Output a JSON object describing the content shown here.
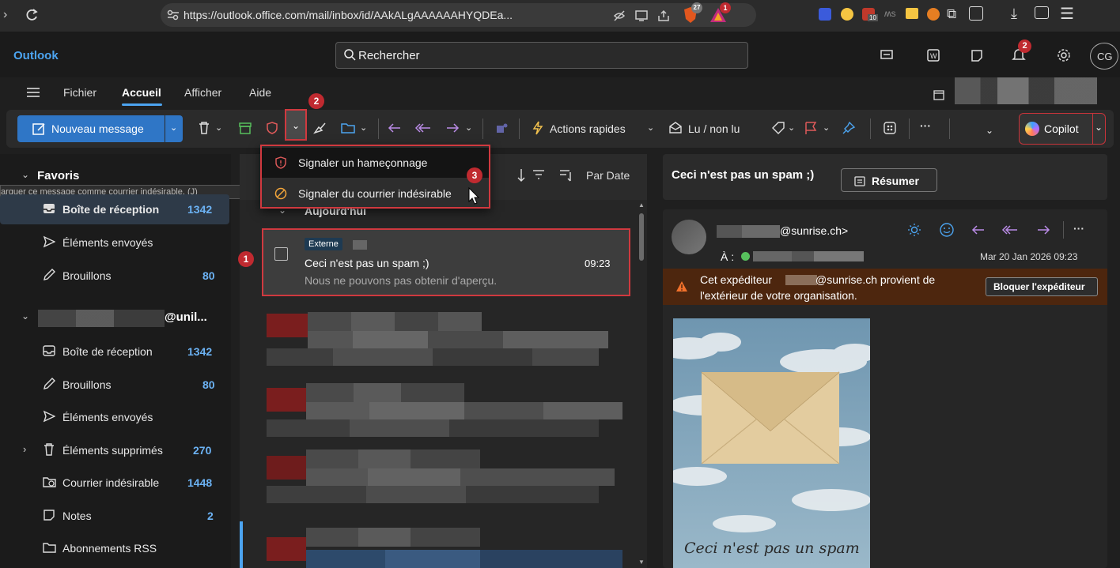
{
  "browser": {
    "url": "https://outlook.office.com/mail/inbox/id/AAkALgAAAAAAHYQDEa...",
    "brave_badge": "27",
    "alert_badge": "1",
    "ext_badge": "10"
  },
  "app": {
    "title": "Outlook",
    "search_placeholder": "Rechercher",
    "notification_count": "2",
    "avatar_initials": "CG"
  },
  "menu": {
    "tabs": [
      "Fichier",
      "Accueil",
      "Afficher",
      "Aide"
    ]
  },
  "ribbon": {
    "new_message": "Nouveau message",
    "quick_actions": "Actions rapides",
    "read_unread": "Lu / non lu",
    "more": "···",
    "copilot": "Copilot"
  },
  "dropdown": {
    "items": [
      "Signaler un hameçonnage",
      "Signaler du courrier indésirable"
    ]
  },
  "tooltip": "arquer ce message comme courrier indésirable. (J)",
  "annotations": [
    "1",
    "2",
    "3"
  ],
  "sidebar": {
    "favorites_label": "Favoris",
    "favorites": [
      {
        "label": "Boîte de réception",
        "count": "1342"
      },
      {
        "label": "Éléments envoyés",
        "count": ""
      },
      {
        "label": "Brouillons",
        "count": "80"
      }
    ],
    "account_label": "@unil...",
    "account_folders": [
      {
        "label": "Boîte de réception",
        "count": "1342"
      },
      {
        "label": "Brouillons",
        "count": "80"
      },
      {
        "label": "Éléments envoyés",
        "count": ""
      },
      {
        "label": "Éléments supprimés",
        "count": "270"
      },
      {
        "label": "Courrier indésirable",
        "count": "1448"
      },
      {
        "label": "Notes",
        "count": "2"
      },
      {
        "label": "Abonnements RSS",
        "count": ""
      }
    ]
  },
  "list": {
    "sort_label": "Par Date",
    "group_label": "Aujourd'hui",
    "selected": {
      "tag": "Externe",
      "subject": "Ceci n'est pas un spam ;)",
      "time": "09:23",
      "preview": "Nous ne pouvons pas obtenir d'aperçu."
    }
  },
  "reading": {
    "subject": "Ceci n'est pas un spam ;)",
    "summarize": "Résumer",
    "sender_suffix": "@sunrise.ch>",
    "to_label": "À :",
    "date": "Mar 20 Jan 2026 09:23",
    "warning_line1": "Cet expéditeur",
    "warning_line1b": "@sunrise.ch provient de",
    "warning_line2": "l'extérieur de votre organisation.",
    "block_sender": "Bloquer l'expéditeur",
    "image_caption": "Ceci n'est pas un spam"
  }
}
